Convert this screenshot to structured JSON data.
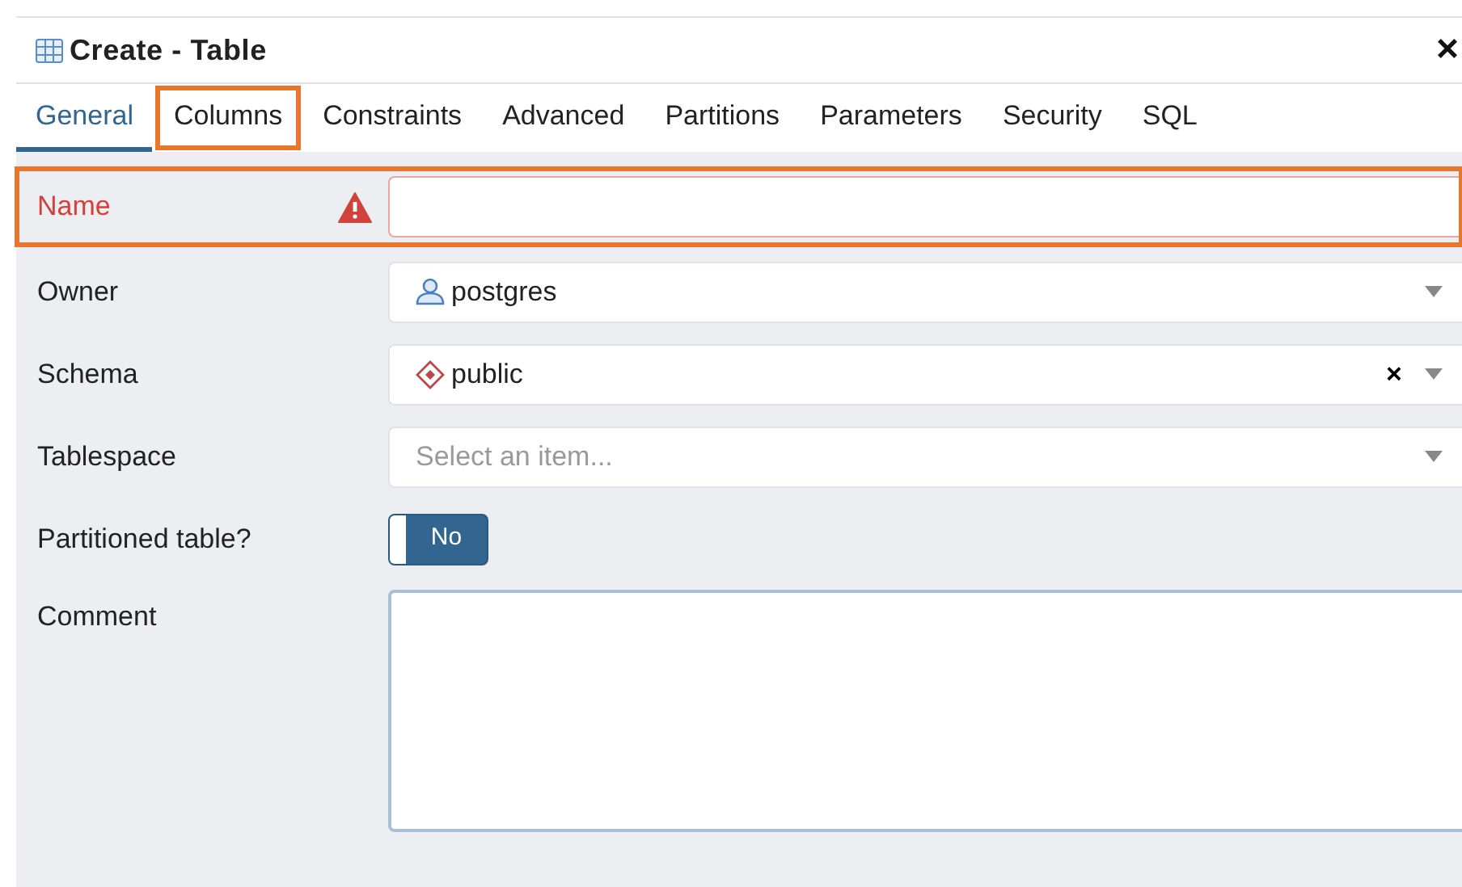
{
  "dialog": {
    "title": "Create - Table",
    "close": "×"
  },
  "tabs": [
    {
      "label": "General",
      "selected": true,
      "highlighted": false
    },
    {
      "label": "Columns",
      "selected": false,
      "highlighted": true
    },
    {
      "label": "Constraints",
      "selected": false,
      "highlighted": false
    },
    {
      "label": "Advanced",
      "selected": false,
      "highlighted": false
    },
    {
      "label": "Partitions",
      "selected": false,
      "highlighted": false
    },
    {
      "label": "Parameters",
      "selected": false,
      "highlighted": false
    },
    {
      "label": "Security",
      "selected": false,
      "highlighted": false
    },
    {
      "label": "SQL",
      "selected": false,
      "highlighted": false
    }
  ],
  "fields": [
    {
      "kind": "text",
      "label": "Name",
      "error": true,
      "highlighted": true
    },
    {
      "kind": "role",
      "label": "Owner",
      "value": "postgres"
    },
    {
      "kind": "schema",
      "label": "Schema",
      "value": "public",
      "clear": "×"
    },
    {
      "kind": "select",
      "label": "Tablespace",
      "placeholder": "Select an item..."
    },
    {
      "kind": "switch",
      "label": "Partitioned table?",
      "on": false,
      "state_label": "No"
    },
    {
      "kind": "textarea",
      "label": "Comment"
    }
  ]
}
